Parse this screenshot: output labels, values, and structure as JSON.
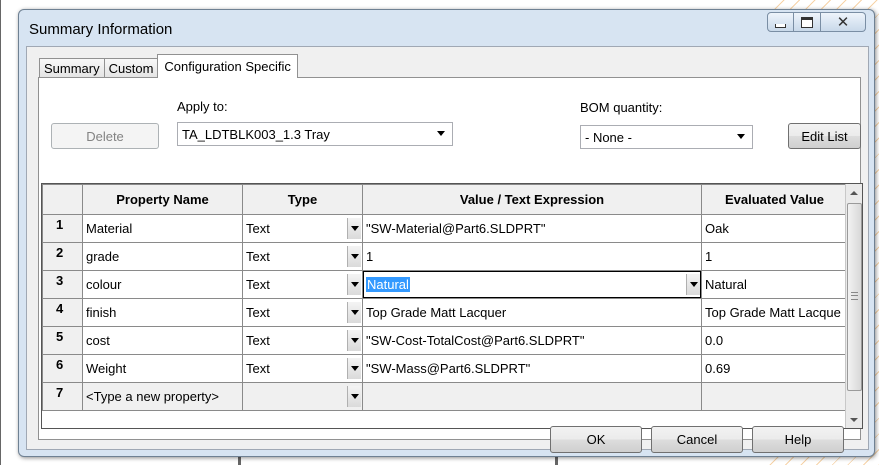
{
  "window": {
    "title": "Summary Information"
  },
  "window_buttons": {
    "minimize_icon": "minimize-icon",
    "maximize_icon": "maximize-icon",
    "close_glyph": "✕"
  },
  "tabs": [
    {
      "label": "Summary",
      "active": false
    },
    {
      "label": "Custom",
      "active": false
    },
    {
      "label": "Configuration Specific",
      "active": true
    }
  ],
  "config": {
    "apply_to_label": "Apply to:",
    "apply_to_value": "TA_LDTBLK003_1.3 Tray",
    "bom_label": "BOM quantity:",
    "bom_value": "- None -",
    "delete_label": "Delete",
    "edit_list_label": "Edit List"
  },
  "grid": {
    "headers": [
      "Property Name",
      "Type",
      "Value / Text Expression",
      "Evaluated Value"
    ],
    "rows": [
      {
        "num": "1",
        "name": "Material",
        "type": "Text",
        "value": "\"SW-Material@Part6.SLDPRT\"",
        "evaluated": "Oak"
      },
      {
        "num": "2",
        "name": "grade",
        "type": "Text",
        "value": "1",
        "evaluated": "1"
      },
      {
        "num": "3",
        "name": "colour",
        "type": "Text",
        "value": "Natural",
        "evaluated": "Natural"
      },
      {
        "num": "4",
        "name": "finish",
        "type": "Text",
        "value": "Top Grade Matt Lacquer",
        "evaluated": "Top Grade Matt Lacque"
      },
      {
        "num": "5",
        "name": "cost",
        "type": "Text",
        "value": "\"SW-Cost-TotalCost@Part6.SLDPRT\"",
        "evaluated": "0.0"
      },
      {
        "num": "6",
        "name": "Weight",
        "type": "Text",
        "value": "\"SW-Mass@Part6.SLDPRT\"",
        "evaluated": "0.69"
      }
    ],
    "new_row": {
      "num": "7",
      "placeholder": "<Type a new property>"
    }
  },
  "footer": {
    "ok_label": "OK",
    "cancel_label": "Cancel",
    "help_label": "Help"
  }
}
